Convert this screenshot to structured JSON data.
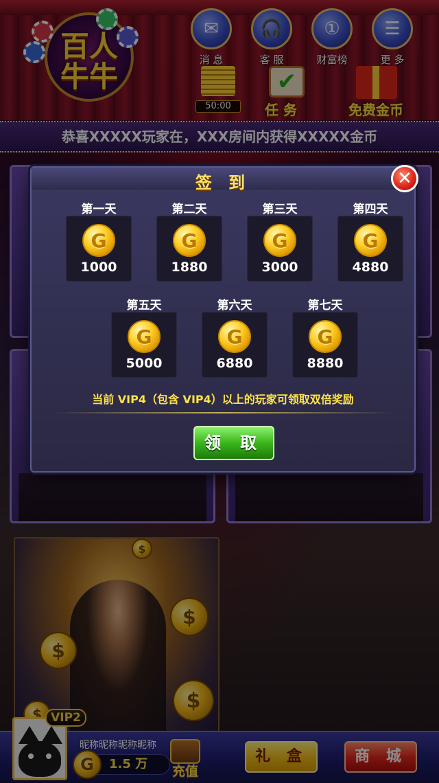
{
  "header": {
    "logo_text_line1": "百人",
    "logo_text_line2": "牛牛",
    "top_buttons": [
      {
        "label": "消 息",
        "icon": "mail-icon"
      },
      {
        "label": "客 服",
        "icon": "headset-icon"
      },
      {
        "label": "财富榜",
        "icon": "medal-icon"
      },
      {
        "label": "更 多",
        "icon": "list-icon"
      }
    ],
    "timer": "50:00",
    "task_label": "任 务",
    "free_coins_label": "免费金币"
  },
  "marquee": {
    "text": "恭喜XXXXX玩家在，XXX房间内获得XXXXX金币"
  },
  "modal": {
    "title": "签 到",
    "close_symbol": "✕",
    "days": [
      {
        "name": "第一天",
        "amount": "1000"
      },
      {
        "name": "第二天",
        "amount": "1880"
      },
      {
        "name": "第三天",
        "amount": "3000"
      },
      {
        "name": "第四天",
        "amount": "4880"
      },
      {
        "name": "第五天",
        "amount": "5000"
      },
      {
        "name": "第六天",
        "amount": "6880"
      },
      {
        "name": "第七天",
        "amount": "8880"
      }
    ],
    "coin_letter": "G",
    "vip_note": "当前 VIP4（包含 VIP4）以上的玩家可领取双倍奖励",
    "claim_button": "领 取"
  },
  "footer": {
    "vip_level": "VIP2",
    "nickname": "昵称昵称昵称昵称",
    "coin_amount": "1.5 万",
    "coin_letter": "G",
    "recharge_label": "充值",
    "gift_button": "礼 盒",
    "shop_button": "商 城"
  }
}
